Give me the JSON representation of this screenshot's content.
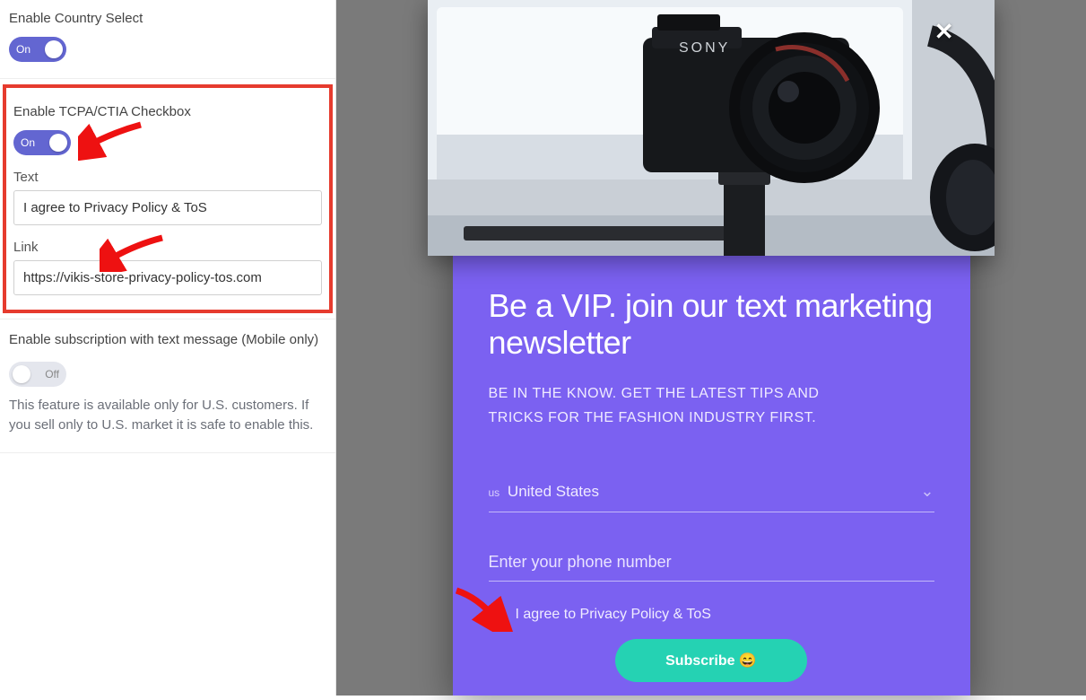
{
  "config": {
    "country_select_heading": "Enable Country Select",
    "country_select_toggle": "On",
    "tcpa_heading": "Enable TCPA/CTIA Checkbox",
    "tcpa_toggle": "On",
    "text_label": "Text",
    "text_value": "I agree to Privacy Policy & ToS",
    "link_label": "Link",
    "link_value": "https://vikis-store-privacy-policy-tos.com",
    "mobile_sub_heading": "Enable subscription with text message (Mobile only)",
    "mobile_sub_toggle": "Off",
    "mobile_sub_note": "This feature is available only for U.S. customers. If you sell only to U.S. market it is safe to enable this."
  },
  "popup": {
    "title": "Be a VIP. join our text marketing newsletter",
    "subtitle": "BE IN THE KNOW. GET THE LATEST TIPS AND TRICKS FOR THE FASHION INDUSTRY FIRST.",
    "country_prefix": "us",
    "country_value": "United States",
    "phone_placeholder": "Enter your phone number",
    "agree_label": "I agree to Privacy Policy & ToS",
    "subscribe_label": "Subscribe 😄"
  }
}
